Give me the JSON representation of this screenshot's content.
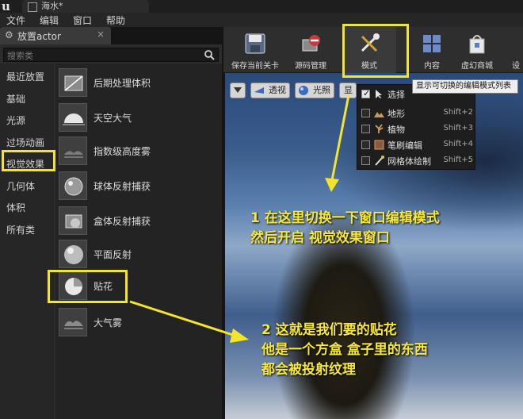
{
  "window": {
    "tab_title": "海水*"
  },
  "menu": {
    "items": [
      "文件",
      "编辑",
      "窗口",
      "帮助"
    ]
  },
  "place_actor": {
    "tab_label": "放置actor",
    "close_glyph": "×",
    "search_placeholder": "搜索类",
    "categories": [
      "最近放置",
      "基础",
      "光源",
      "过场动画",
      "视觉效果",
      "几何体",
      "体积",
      "所有类"
    ],
    "selected_category": "视觉效果",
    "items": [
      {
        "label": "后期处理体积",
        "icon": "post-process-volume-icon"
      },
      {
        "label": "天空大气",
        "icon": "sky-atmosphere-icon"
      },
      {
        "label": "指数级高度雾",
        "icon": "height-fog-icon"
      },
      {
        "label": "球体反射捕获",
        "icon": "sphere-reflection-icon"
      },
      {
        "label": "盒体反射捕获",
        "icon": "box-reflection-icon"
      },
      {
        "label": "平面反射",
        "icon": "planar-reflection-icon"
      },
      {
        "label": "贴花",
        "icon": "decal-icon"
      },
      {
        "label": "大气雾",
        "icon": "atmospheric-fog-icon"
      }
    ]
  },
  "toolbar": {
    "save_label": "保存当前关卡",
    "source_label": "源码管理",
    "modes_label": "模式",
    "content_label": "内容",
    "marketplace_label": "虚幻商城",
    "overflow_label": "设"
  },
  "viewport": {
    "perspective_label": "透视",
    "lit_label": "光照",
    "show_label": "显"
  },
  "tooltip": {
    "text": "显示可切换的编辑模式列表"
  },
  "modes_dropdown": {
    "items": [
      {
        "label": "选择",
        "shortcut": "",
        "checked": true,
        "icon": "select-arrow-icon"
      },
      {
        "label": "地形",
        "shortcut": "Shift+2",
        "checked": false,
        "icon": "landscape-icon"
      },
      {
        "label": "植物",
        "shortcut": "Shift+3",
        "checked": false,
        "icon": "foliage-icon"
      },
      {
        "label": "笔刷编辑",
        "shortcut": "Shift+4",
        "checked": false,
        "icon": "brush-edit-icon"
      },
      {
        "label": "网格体绘制",
        "shortcut": "Shift+5",
        "checked": false,
        "icon": "mesh-paint-icon"
      }
    ]
  },
  "annotations": {
    "note1_line1": "1 在这里切换一下窗口编辑模式",
    "note1_line2": "然后开启   视觉效果窗口",
    "note2_line1": "2 这就是我们要的贴花",
    "note2_line2": "他是一个方盒 盒子里的东西",
    "note2_line3": "都会被投射纹理",
    "color": "#f4e42c"
  }
}
